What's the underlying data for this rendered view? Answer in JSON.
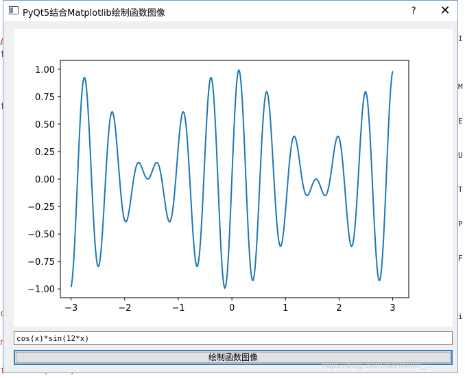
{
  "window": {
    "title": "PyQt5结合Matplotlib绘制函数图像",
    "help_label": "?",
    "close_label": "✕"
  },
  "function_input": {
    "value": "cos(x)*sin(12*x)"
  },
  "draw_button": {
    "label": "绘制函数图像"
  },
  "watermark": "https://blog.csdn.net/weixin_...",
  "chart_data": {
    "type": "line",
    "function": "cos(x)*sin(12*x)",
    "title": "",
    "xlabel": "",
    "ylabel": "",
    "xlim": [
      -3.2,
      3.3
    ],
    "ylim": [
      -1.08,
      1.08
    ],
    "xticks": [
      -3,
      -2,
      -1,
      0,
      1,
      2,
      3
    ],
    "xtick_labels": [
      "−3",
      "−2",
      "−1",
      "0",
      "1",
      "2",
      "3"
    ],
    "yticks": [
      1.0,
      0.75,
      0.5,
      0.25,
      0.0,
      -0.25,
      -0.5,
      -0.75,
      -1.0
    ],
    "ytick_labels": [
      "1.00",
      "0.75",
      "0.50",
      "0.25",
      "0.00",
      "−0.25",
      "−0.50",
      "−0.75",
      "−1.00"
    ],
    "x_range": [
      -3,
      3
    ],
    "samples": 500,
    "line_color": "#1f77b4",
    "grid": false,
    "series": [
      {
        "values_from": "function"
      }
    ]
  }
}
